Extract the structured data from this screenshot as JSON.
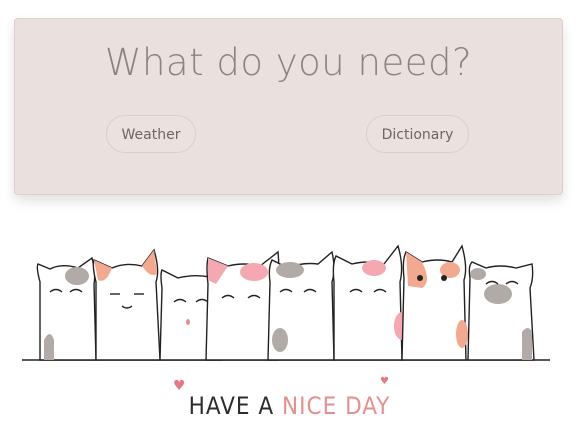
{
  "header": {
    "title": "What do you need?"
  },
  "buttons": {
    "weather": "Weather",
    "dictionary": "Dictionary"
  },
  "tagline": {
    "part1": "HAVE A",
    "part2": "NICE DAY"
  },
  "colors": {
    "card_bg": "#eae0de",
    "accent_pink": "#e58f91",
    "cat_orange": "#f3a98f",
    "cat_gray": "#b1aaa6"
  }
}
